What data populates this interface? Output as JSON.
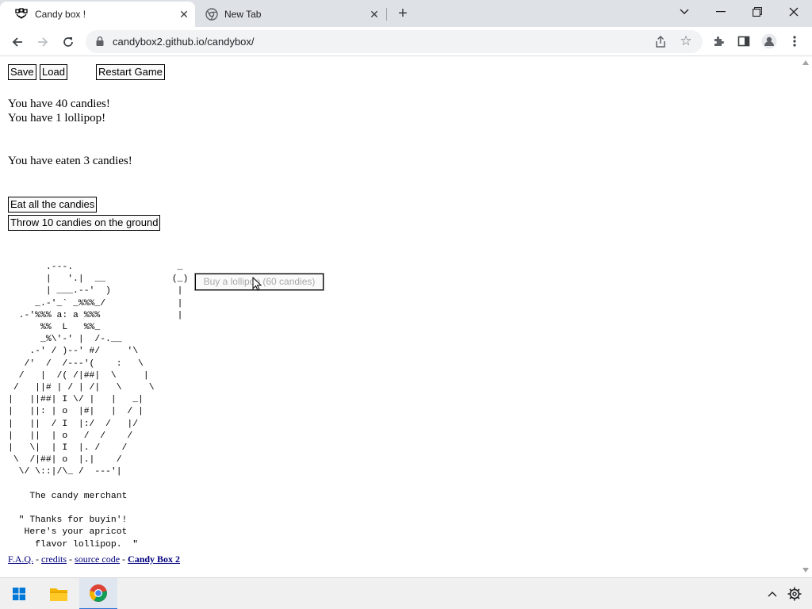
{
  "browser": {
    "tabs": [
      {
        "title": "Candy box !",
        "active": true,
        "icon": "candy-box-favicon"
      },
      {
        "title": "New Tab",
        "active": false,
        "icon": "chrome-favicon"
      }
    ],
    "address": "candybox2.github.io/candybox/"
  },
  "game": {
    "save_label": "Save",
    "load_label": "Load",
    "restart_label": "Restart Game",
    "candies_text": "You have 40 candies!",
    "lollipop_text": "You have 1 lollipop!",
    "eaten_text": "You have eaten 3 candies!",
    "eat_button": "Eat all the candies",
    "throw_button": "Throw 10 candies on the ground",
    "merchant_ascii": "       .---.\n       |   '.|  __\n       | ___.--'  )\n     _.-'_` _%%%_/\n  .-'%%% a: a %%%\n      %%  L   %%_\n      _%\\'-' |  /-.__\n    .-' / )--' #/     '\\\n   /'  /  /---'(    :   \\\n  /   |  /( /|##|  \\     |\n /   ||# | / | /|   \\     \\\n|   ||##| I \\/ |   |   _|\n|   ||: | o  |#|   |  / |\n|   ||  / I  |:/  /   |/\n|   ||  | o   /  /    /\n|   \\|  | I  |. /    /\n \\  /|##| o  |.|    /\n  \\/ \\::|/\\_ /  ---'|\n\n    The candy merchant\n\n  \" Thanks for buyin'!\n   Here's your apricot\n     flavor lollipop.  \"",
    "lollipop_ascii": "  _\n (_)\n  |\n  |\n  |",
    "buy_button": "Buy a lollipop (60 candies)",
    "footer": {
      "faq": "F.A.Q.",
      "credits": "credits",
      "source": "source code",
      "candybox2": "Candy Box 2",
      "sep": " - "
    }
  },
  "colors": {
    "tabbar_bg": "#dee1e6",
    "omnibox_bg": "#f1f3f4",
    "link": "#000080",
    "disabled_text": "#a8a8a8",
    "taskbar_bg": "#f0f0f0",
    "windows_blue": "#0078d7"
  }
}
